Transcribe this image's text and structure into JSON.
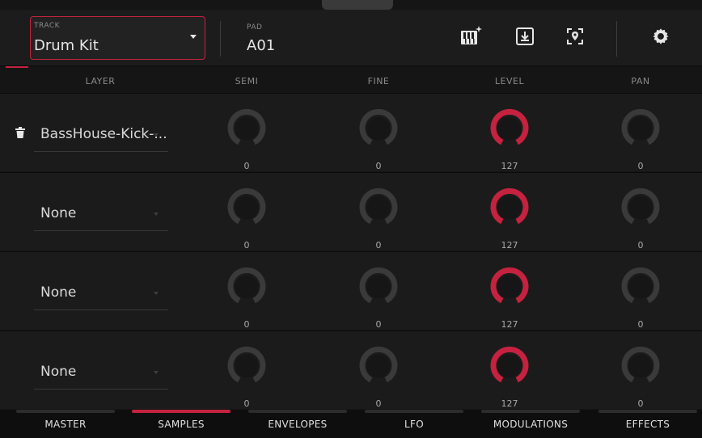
{
  "header": {
    "track_label": "TRACK",
    "track_value": "Drum Kit",
    "pad_label": "PAD",
    "pad_value": "A01",
    "icons": [
      "keyboard-sparkle-icon",
      "download-icon",
      "locate-icon",
      "gear-icon"
    ]
  },
  "columns": {
    "layer": "LAYER",
    "semi": "SEMI",
    "fine": "FINE",
    "level": "LEVEL",
    "pan": "PAN"
  },
  "rows": [
    {
      "layer": "BassHouse-Kick-...",
      "semi": "0",
      "fine": "0",
      "level": "127",
      "pan": "0",
      "has_delete": true
    },
    {
      "layer": "None",
      "semi": "0",
      "fine": "0",
      "level": "127",
      "pan": "0",
      "has_delete": false
    },
    {
      "layer": "None",
      "semi": "0",
      "fine": "0",
      "level": "127",
      "pan": "0",
      "has_delete": false
    },
    {
      "layer": "None",
      "semi": "0",
      "fine": "0",
      "level": "127",
      "pan": "0",
      "has_delete": false
    }
  ],
  "tabs": [
    {
      "label": "MASTER",
      "active": false
    },
    {
      "label": "SAMPLES",
      "active": true
    },
    {
      "label": "ENVELOPES",
      "active": false
    },
    {
      "label": "LFO",
      "active": false
    },
    {
      "label": "MODULATIONS",
      "active": false
    },
    {
      "label": "EFFECTS",
      "active": false
    }
  ],
  "colors": {
    "accent": "#c5223f",
    "knob_track": "#3a3a3a",
    "knob_body": "#161616"
  }
}
